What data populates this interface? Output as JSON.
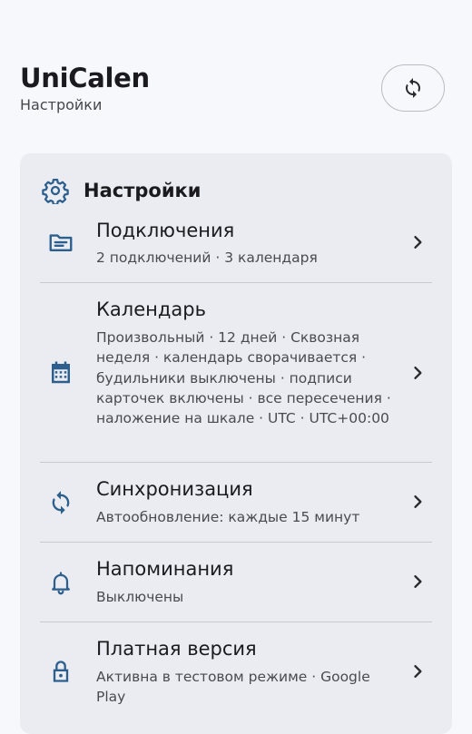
{
  "header": {
    "app_title": "UniCalen",
    "subtitle": "Настройки"
  },
  "card": {
    "title": "Настройки",
    "items": [
      {
        "title": "Подключения",
        "subtitle": "2 подключений · 3 календаря",
        "icon": "folder-icon"
      },
      {
        "title": "Календарь",
        "subtitle": "Произвольный · 12 дней · Сквозная неделя · календарь сворачивается · будильники выключены · подписи карточек включены · все пересечения · наложение на шкале · UTC · UTC+00:00",
        "icon": "calendar-icon"
      },
      {
        "title": "Синхронизация",
        "subtitle": "Автообновление: каждые 15 минут",
        "icon": "sync-icon"
      },
      {
        "title": "Напоминания",
        "subtitle": "Выключены",
        "icon": "bell-icon"
      },
      {
        "title": "Платная версия",
        "subtitle": "Активна в тестовом режиме · Google Play",
        "icon": "lock-icon"
      }
    ]
  },
  "colors": {
    "accent": "#2c5f8d",
    "background": "#f7f8fc",
    "card": "#eaecf1"
  }
}
